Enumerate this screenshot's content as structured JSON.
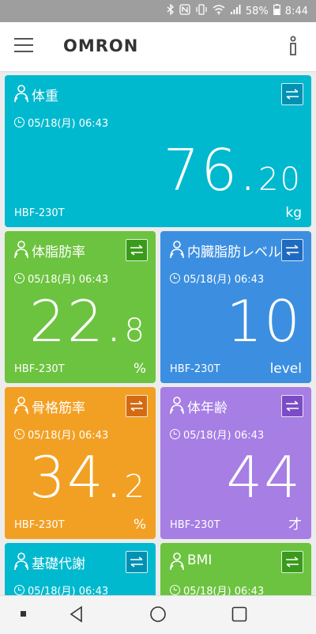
{
  "status_bar": {
    "battery": "58%",
    "time": "8:44"
  },
  "app": {
    "logo": "OMRON"
  },
  "cards": [
    {
      "title": "体重",
      "date": "05/18(月) 06:43",
      "value_int": "76.",
      "value_dec": "20",
      "unit": "kg",
      "device": "HBF-230T",
      "color": "#00b9cf",
      "swap_color": "#0091b3"
    },
    {
      "title": "体脂肪率",
      "date": "05/18(月) 06:43",
      "value_int": "22.",
      "value_dec": "8",
      "unit": "%",
      "device": "HBF-230T",
      "color": "#6cc33f",
      "swap_color": "#3a9a1c"
    },
    {
      "title": "内臓脂肪レベル",
      "date": "05/18(月) 06:43",
      "value_int": "10",
      "value_dec": "",
      "unit": "level",
      "device": "HBF-230T",
      "color": "#3c8fe0",
      "swap_color": "#1f6ac0"
    },
    {
      "title": "骨格筋率",
      "date": "05/18(月) 06:43",
      "value_int": "34.",
      "value_dec": "2",
      "unit": "%",
      "device": "HBF-230T",
      "color": "#f2a023",
      "swap_color": "#d46a12"
    },
    {
      "title": "体年齢",
      "date": "05/18(月) 06:43",
      "value_int": "44",
      "value_dec": "",
      "unit": "才",
      "device": "HBF-230T",
      "color": "#a67ee4",
      "swap_color": "#7c4cc6"
    },
    {
      "title": "基礎代謝",
      "date": "05/18(月) 06:43",
      "value_int": "",
      "value_dec": "",
      "unit": "",
      "device": "",
      "color": "#00b9cf",
      "swap_color": "#0091b3"
    },
    {
      "title": "BMI",
      "date": "05/18(月) 06:43",
      "value_int": "",
      "value_dec": "",
      "unit": "",
      "device": "",
      "color": "#6cc33f",
      "swap_color": "#3a9a1c"
    }
  ]
}
